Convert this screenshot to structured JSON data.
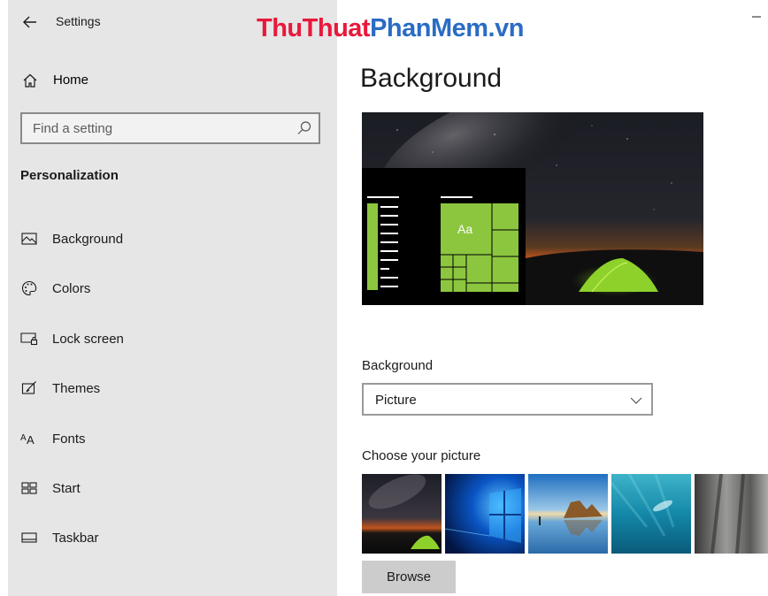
{
  "window": {
    "title": "Settings",
    "back_icon": "back-arrow-icon",
    "minimize_icon": "minimize-icon"
  },
  "watermark": {
    "part1": "ThuThuat",
    "part2": "PhanMem.vn",
    "color1": "#e8193c",
    "color2": "#2a6cc4"
  },
  "sidebar": {
    "home_label": "Home",
    "search_placeholder": "Find a setting",
    "section_title": "Personalization",
    "items": [
      {
        "label": "Background",
        "icon": "picture-icon"
      },
      {
        "label": "Colors",
        "icon": "palette-icon"
      },
      {
        "label": "Lock screen",
        "icon": "lock-screen-icon"
      },
      {
        "label": "Themes",
        "icon": "brush-icon"
      },
      {
        "label": "Fonts",
        "icon": "font-icon"
      },
      {
        "label": "Start",
        "icon": "start-icon"
      },
      {
        "label": "Taskbar",
        "icon": "taskbar-icon"
      }
    ]
  },
  "main": {
    "title": "Background",
    "preview": {
      "tile_text": "Aa",
      "accent": "#8cc63f"
    },
    "background_label": "Background",
    "background_value": "Picture",
    "choose_label": "Choose your picture",
    "browse_label": "Browse"
  }
}
